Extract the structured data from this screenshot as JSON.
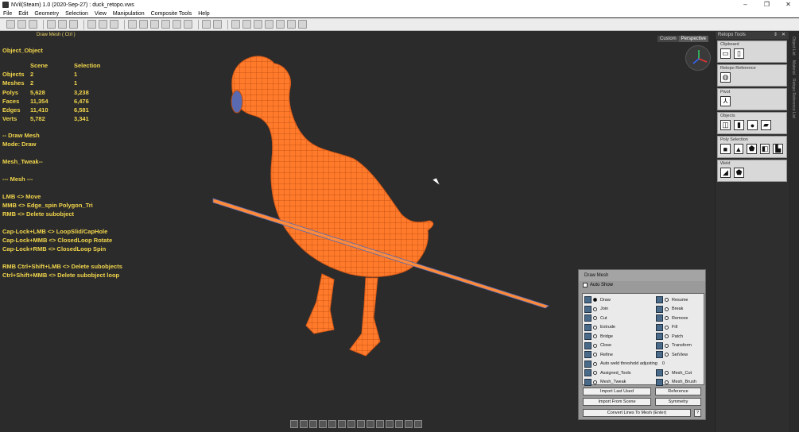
{
  "window": {
    "title": "NVil(Steam) 1.0 (2020-Sep-27) : duck_retopo.vws",
    "buttons": [
      "–",
      "❐",
      "✕"
    ]
  },
  "menu": [
    "File",
    "Edit",
    "Geometry",
    "Selection",
    "View",
    "Manipulation",
    "Composite Tools",
    "Help"
  ],
  "command_label": "Draw Mesh  ( Ctrl )",
  "info": {
    "object": "Object_Object",
    "stats_header": [
      "",
      "Scene",
      "Selection"
    ],
    "stats": [
      [
        "Objects",
        "2",
        "1"
      ],
      [
        "Meshes",
        "2",
        "1"
      ],
      [
        "Polys",
        "5,628",
        "3,238"
      ],
      [
        "Faces",
        "11,354",
        "6,476"
      ],
      [
        "Edges",
        "11,410",
        "6,581"
      ],
      [
        "Verts",
        "5,782",
        "3,341"
      ]
    ],
    "lines": [
      "-- Draw Mesh",
      "Mode: Draw",
      "",
      "Mesh_Tweak--",
      "",
      "--- Mesh ---",
      "",
      "LMB <> Move",
      "MMB <> Edge_spin Polygon_Tri",
      "RMB <> Delete subobject",
      "",
      "Cap-Lock+LMB <> LoopSlid/CapHole",
      "Cap-Lock+MMB <> ClosedLoop Rotate",
      "Cap-Lock+RMB <> ClosedLoop Spin",
      "",
      "RMB Ctrl+Shift+LMB <> Delete subobjects",
      "Ctrl+Shift+MMB <> Delete subobject loop"
    ]
  },
  "view_tabs": [
    "Custom",
    "Perspective"
  ],
  "panel": {
    "title": "Retopo Tools",
    "pin": "⇕",
    "close": "✕",
    "groups": [
      {
        "label": "Clipboard",
        "icons": [
          "copy-icon",
          "paste-icon"
        ]
      },
      {
        "label": "Retopo Reference",
        "icons": [
          "sphere-icon"
        ]
      },
      {
        "label": "Pivot",
        "icons": [
          "axis-icon"
        ]
      },
      {
        "label": "Objects",
        "icons": [
          "cube-icon",
          "cylinder-icon",
          "sphere-icon",
          "plane-icon"
        ]
      },
      {
        "label": "Poly Selection",
        "icons": [
          "square-icon",
          "triangle-icon",
          "pentagon-icon",
          "box-icon",
          "lshape-icon"
        ]
      },
      {
        "label": "Weld",
        "icons": [
          "weld-tri-icon",
          "weld-pent-icon"
        ]
      }
    ]
  },
  "side_tabs": [
    "Object List",
    "Material",
    "Retopo Reference List"
  ],
  "draw_mesh": {
    "title": "Draw Mesh",
    "auto_show": "Auto Show",
    "left_options": [
      "Draw",
      "Join",
      "Cut",
      "Extrude",
      "Bridge",
      "Close",
      "Refine"
    ],
    "right_options": [
      "Resume",
      "Break",
      "Remove",
      "Fill",
      "Patch",
      "Transform",
      "SetView"
    ],
    "auto_weld": "Auto weld threshold adjusting",
    "auto_weld_value": "0",
    "extra_left": [
      "Assigned_Tools",
      "Mesh_Tweak"
    ],
    "extra_right": [
      "Mesh_Cut",
      "Mesh_Brush"
    ],
    "buttons": {
      "import_last": "Import Last Used",
      "reference": "Reference",
      "import_scene": "Import From Scene",
      "symmetry": "Symmetry",
      "convert": "Convert Lines To Mesh (Enter)",
      "help": "?"
    }
  },
  "colors": {
    "info_text": "#f2d64b",
    "mesh": "#ff7a2a",
    "mesh_wire": "#b84a10",
    "viewport": "#2b2b2b"
  }
}
